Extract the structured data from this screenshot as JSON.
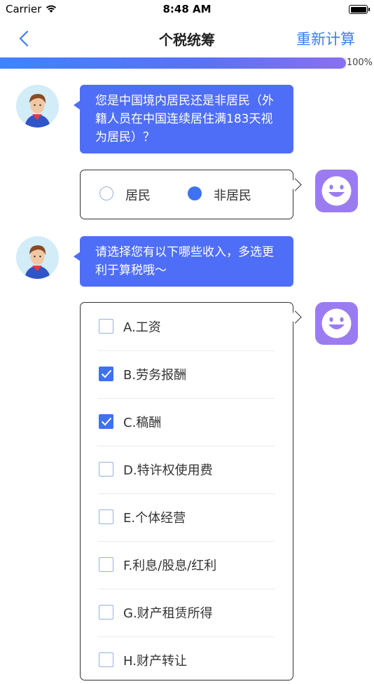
{
  "status": {
    "carrier": "Carrier",
    "time": "8:48 AM"
  },
  "nav": {
    "title": "个税统筹",
    "action": "重新计算"
  },
  "progress": {
    "value": 1.0,
    "label": "100%"
  },
  "messages": [
    {
      "question": "您是中国境内居民还是非居民（外籍人员在中国连续居住满183天视为居民）？"
    },
    {
      "question": "请选择您有以下哪些收入，多选更利于算税哦～"
    }
  ],
  "residency": {
    "options": [
      {
        "label": "居民",
        "selected": false
      },
      {
        "label": "非居民",
        "selected": true
      }
    ]
  },
  "income": {
    "options": [
      {
        "label": "A.工资",
        "checked": false
      },
      {
        "label": "B.劳务报酬",
        "checked": true
      },
      {
        "label": "C.稿酬",
        "checked": true
      },
      {
        "label": "D.特许权使用费",
        "checked": false
      },
      {
        "label": "E.个体经营",
        "checked": false
      },
      {
        "label": "F.利息/股息/红利",
        "checked": false
      },
      {
        "label": "G.财产租赁所得",
        "checked": false
      },
      {
        "label": "H.财产转让",
        "checked": false
      }
    ]
  },
  "colors": {
    "accent": "#4f6ef7",
    "link": "#3d7ef0",
    "bot": "#9b7cf0"
  },
  "icons": {
    "back": "chevron-left-icon",
    "user": "smiley-face-icon",
    "bot": "advisor-avatar"
  }
}
